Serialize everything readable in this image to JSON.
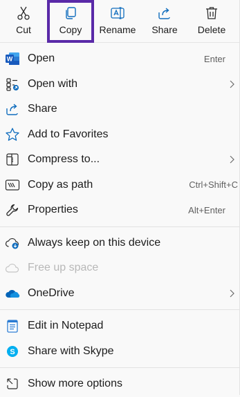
{
  "toolbar": {
    "buttons": [
      {
        "label": "Cut",
        "icon": "scissors-icon"
      },
      {
        "label": "Copy",
        "icon": "copy-icon"
      },
      {
        "label": "Rename",
        "icon": "rename-icon"
      },
      {
        "label": "Share",
        "icon": "share-icon"
      },
      {
        "label": "Delete",
        "icon": "trash-icon"
      }
    ],
    "highlight_color": "#5a2aa8"
  },
  "menu": {
    "group1": [
      {
        "label": "Open",
        "shortcut": "Enter",
        "icon": "word-icon"
      },
      {
        "label": "Open with",
        "icon": "open-with-icon"
      },
      {
        "label": "Share",
        "icon": "share-icon"
      },
      {
        "label": "Add to Favorites",
        "icon": "star-icon"
      },
      {
        "label": "Compress to...",
        "icon": "zip-icon"
      },
      {
        "label": "Copy as path",
        "shortcut": "Ctrl+Shift+C",
        "icon": "copy-path-icon"
      },
      {
        "label": "Properties",
        "shortcut": "Alt+Enter",
        "icon": "wrench-icon"
      }
    ],
    "group2": [
      {
        "label": "Always keep on this device",
        "icon": "cloud-download-icon"
      },
      {
        "label": "Free up space",
        "icon": "cloud-outline-icon"
      },
      {
        "label": "OneDrive",
        "icon": "onedrive-icon"
      }
    ],
    "group3": [
      {
        "label": "Edit in Notepad",
        "icon": "notepad-icon"
      },
      {
        "label": "Share with Skype",
        "icon": "skype-icon"
      }
    ],
    "group4": [
      {
        "label": "Show more options",
        "icon": "show-more-icon"
      }
    ]
  },
  "colors": {
    "accent_blue": "#0f6cbd",
    "word_blue": "#185abd",
    "onedrive_blue": "#0364b8",
    "skype_blue": "#00aff0"
  }
}
